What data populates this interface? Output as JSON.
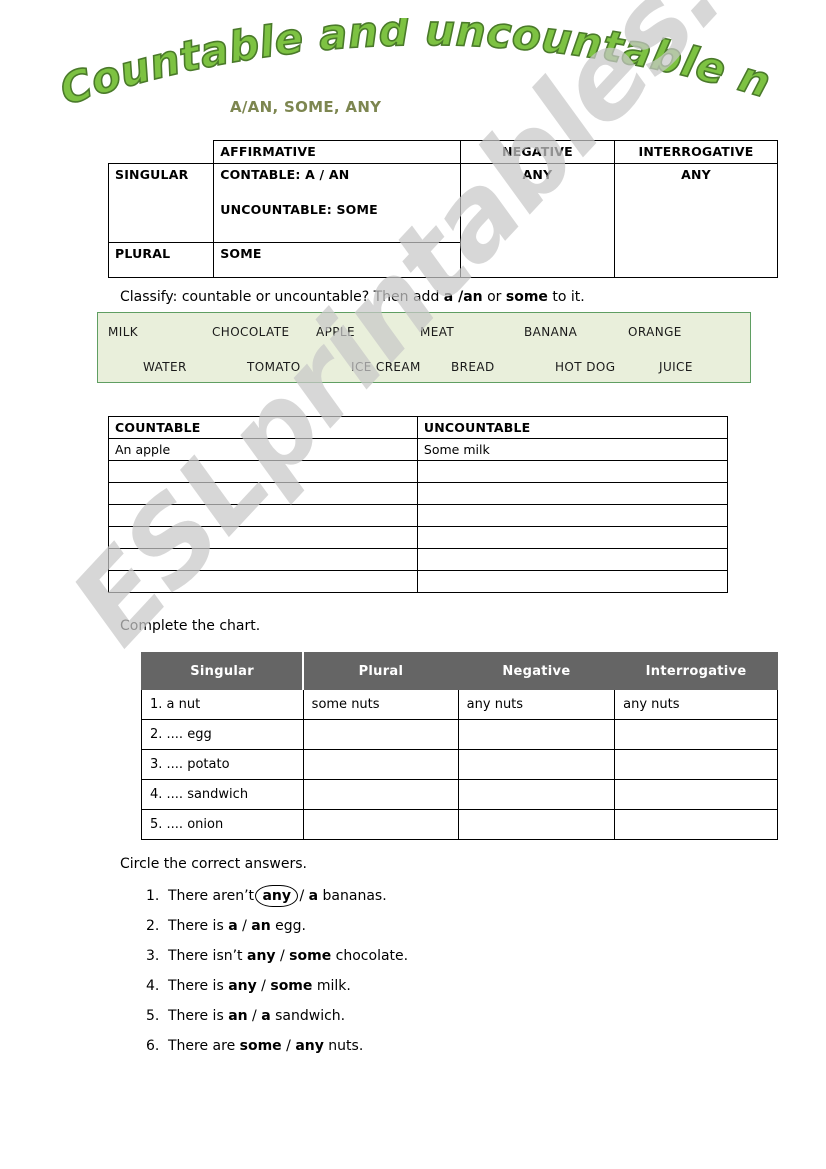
{
  "title": {
    "text": "Countable and uncountable nouns",
    "fill_color": "#7dc242",
    "outline_color": "#4a7a2a"
  },
  "subtitle": {
    "text": "A/AN, SOME, ANY",
    "color": "#7d8650"
  },
  "watermark": {
    "text": "ESLprintables.com",
    "color": "#c9c9c9"
  },
  "rules_table": {
    "corner": "",
    "headers": {
      "affirmative": "AFFIRMATIVE",
      "negative": "NEGATIVE",
      "interrogative": "INTERROGATIVE"
    },
    "rows": [
      {
        "label": "SINGULAR",
        "affirmative_line1": "CONTABLE: A / AN",
        "affirmative_line2": "UNCOUNTABLE: SOME",
        "negative": "ANY",
        "interrogative": "ANY"
      },
      {
        "label": "PLURAL",
        "affirmative_line1": "SOME",
        "affirmative_line2": ""
      }
    ]
  },
  "classify": {
    "instruction_part1": "Classify: countable or uncountable? Then add ",
    "instruction_bold1": "a /an",
    "instruction_part2": " or ",
    "instruction_bold2": "some",
    "instruction_part3": " to it.",
    "word_bank_bg": "#e9efdb",
    "word_bank_border": "#5f9e62",
    "words_row1": [
      "MILK",
      "CHOCOLATE",
      "APPLE",
      "MEAT",
      "BANANA",
      "ORANGE"
    ],
    "words_row2": [
      "WATER",
      "TOMATO",
      "ICE CREAM",
      "BREAD",
      "HOT DOG",
      "JUICE"
    ]
  },
  "sort_table": {
    "headers": [
      "COUNTABLE",
      "UNCOUNTABLE"
    ],
    "rows": [
      [
        "An apple",
        "Some milk"
      ],
      [
        "",
        ""
      ],
      [
        "",
        ""
      ],
      [
        "",
        ""
      ],
      [
        "",
        ""
      ],
      [
        "",
        ""
      ],
      [
        "",
        ""
      ]
    ]
  },
  "chart": {
    "instruction": "Complete the chart.",
    "header_bg": "#656565",
    "headers": [
      "Singular",
      "Plural",
      "Negative",
      "Interrogative"
    ],
    "rows": [
      [
        "1.  a nut",
        "some nuts",
        "any nuts",
        "any nuts"
      ],
      [
        "2. .... egg",
        "",
        "",
        ""
      ],
      [
        "3. .... potato",
        "",
        "",
        ""
      ],
      [
        "4. .... sandwich",
        "",
        "",
        ""
      ],
      [
        "5. .... onion",
        "",
        "",
        ""
      ]
    ]
  },
  "circle_exercise": {
    "instruction": "Circle the correct answers.",
    "items": [
      {
        "num": "1.",
        "pre": "There aren’t ",
        "opt_a": "any",
        "opt_a_circled": true,
        "sep": " / ",
        "opt_b": "a",
        "post": " bananas."
      },
      {
        "num": "2.",
        "pre": "There is ",
        "opt_a": "a",
        "opt_a_circled": false,
        "sep": " / ",
        "opt_b": "an",
        "post": " egg."
      },
      {
        "num": "3.",
        "pre": "There isn’t ",
        "opt_a": "any",
        "opt_a_circled": false,
        "sep": " / ",
        "opt_b": "some",
        "post": " chocolate."
      },
      {
        "num": "4.",
        "pre": "There is ",
        "opt_a": "any",
        "opt_a_circled": false,
        "sep": " / ",
        "opt_b": "some",
        "post": " milk."
      },
      {
        "num": "5.",
        "pre": "There is ",
        "opt_a": "an",
        "opt_a_circled": false,
        "sep": " / ",
        "opt_b": "a",
        "post": " sandwich."
      },
      {
        "num": "6.",
        "pre": "There are ",
        "opt_a": "some",
        "opt_a_circled": false,
        "sep": " / ",
        "opt_b": "any",
        "post": " nuts."
      }
    ]
  }
}
